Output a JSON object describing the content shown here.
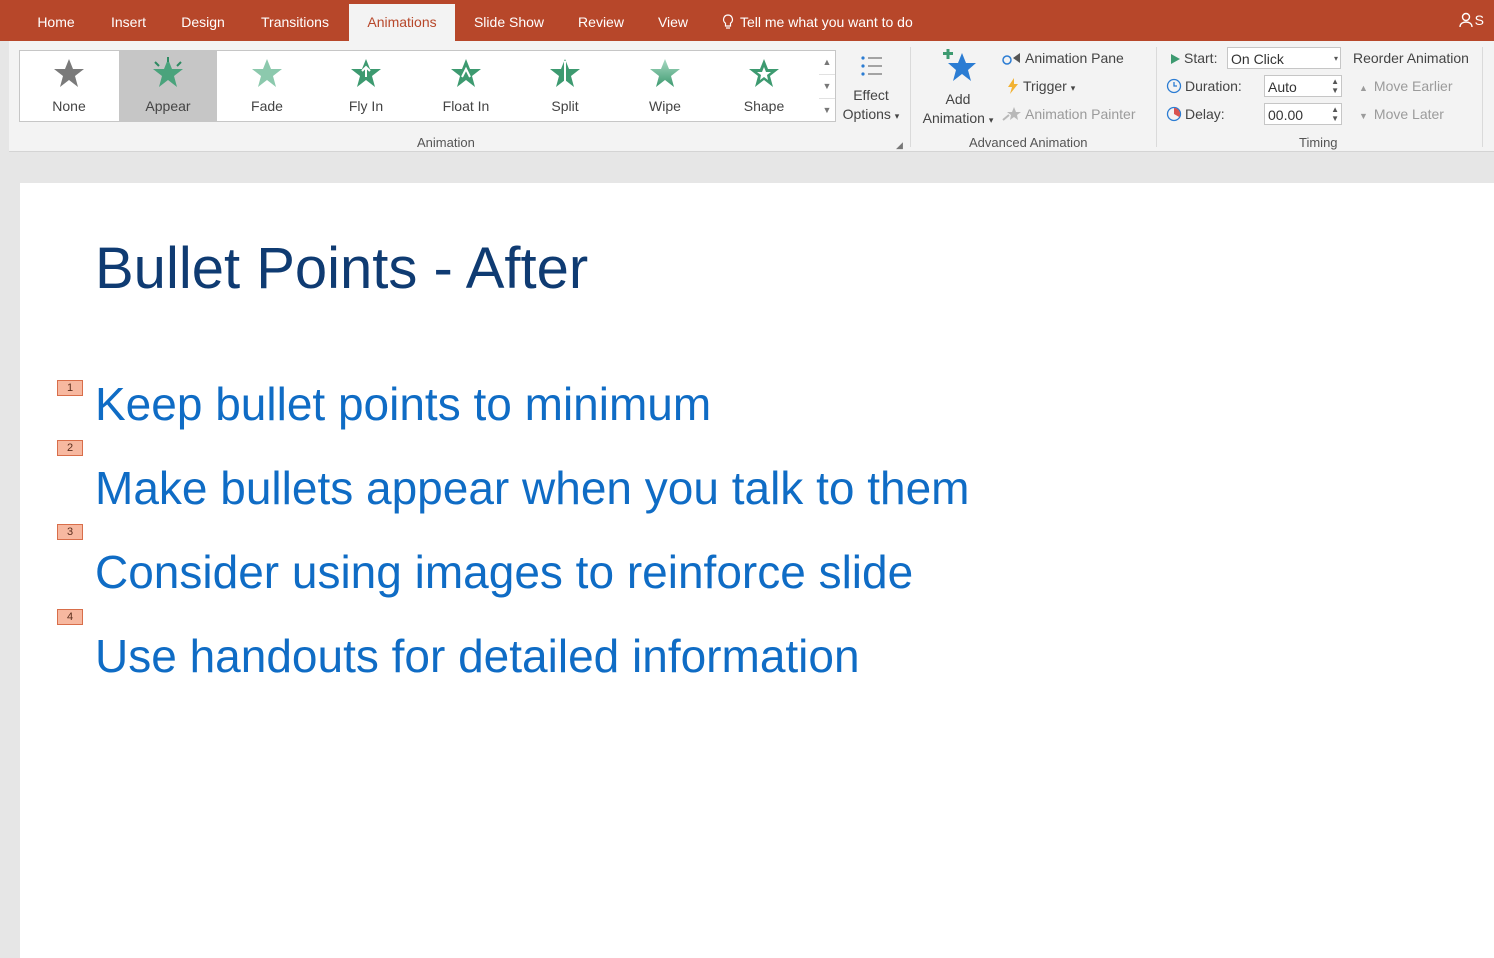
{
  "tabs": [
    "Home",
    "Insert",
    "Design",
    "Transitions",
    "Animations",
    "Slide Show",
    "Review",
    "View"
  ],
  "active_tab": "Animations",
  "tell_me": "Tell me what you want to do",
  "account_label": "S",
  "animation_gallery": {
    "items": [
      "None",
      "Appear",
      "Fade",
      "Fly In",
      "Float In",
      "Split",
      "Wipe",
      "Shape"
    ],
    "selected": "Appear",
    "group_label": "Animation"
  },
  "effect_options": {
    "line1": "Effect",
    "line2": "Options"
  },
  "advanced_animation": {
    "add_line1": "Add",
    "add_line2": "Animation",
    "animation_pane": "Animation Pane",
    "trigger": "Trigger",
    "animation_painter": "Animation Painter",
    "group_label": "Advanced Animation"
  },
  "timing": {
    "start_label": "Start:",
    "start_value": "On Click",
    "duration_label": "Duration:",
    "duration_value": "Auto",
    "delay_label": "Delay:",
    "delay_value": "00.00",
    "group_label": "Timing"
  },
  "reorder": {
    "title": "Reorder Animation",
    "move_earlier": "Move Earlier",
    "move_later": "Move Later"
  },
  "slide": {
    "title": "Bullet Points - After",
    "bullets": [
      {
        "tag": "1",
        "text": "Keep bullet points to minimum"
      },
      {
        "tag": "2",
        "text": "Make bullets appear when you talk to them"
      },
      {
        "tag": "3",
        "text": "Consider using images to reinforce slide"
      },
      {
        "tag": "4",
        "text": "Use handouts for detailed information"
      }
    ]
  },
  "colors": {
    "ribbon_accent": "#b7472a",
    "title_text": "#0f3b72",
    "bullet_text": "#0f6cc5",
    "anim_tag": "#f7b8a0"
  }
}
